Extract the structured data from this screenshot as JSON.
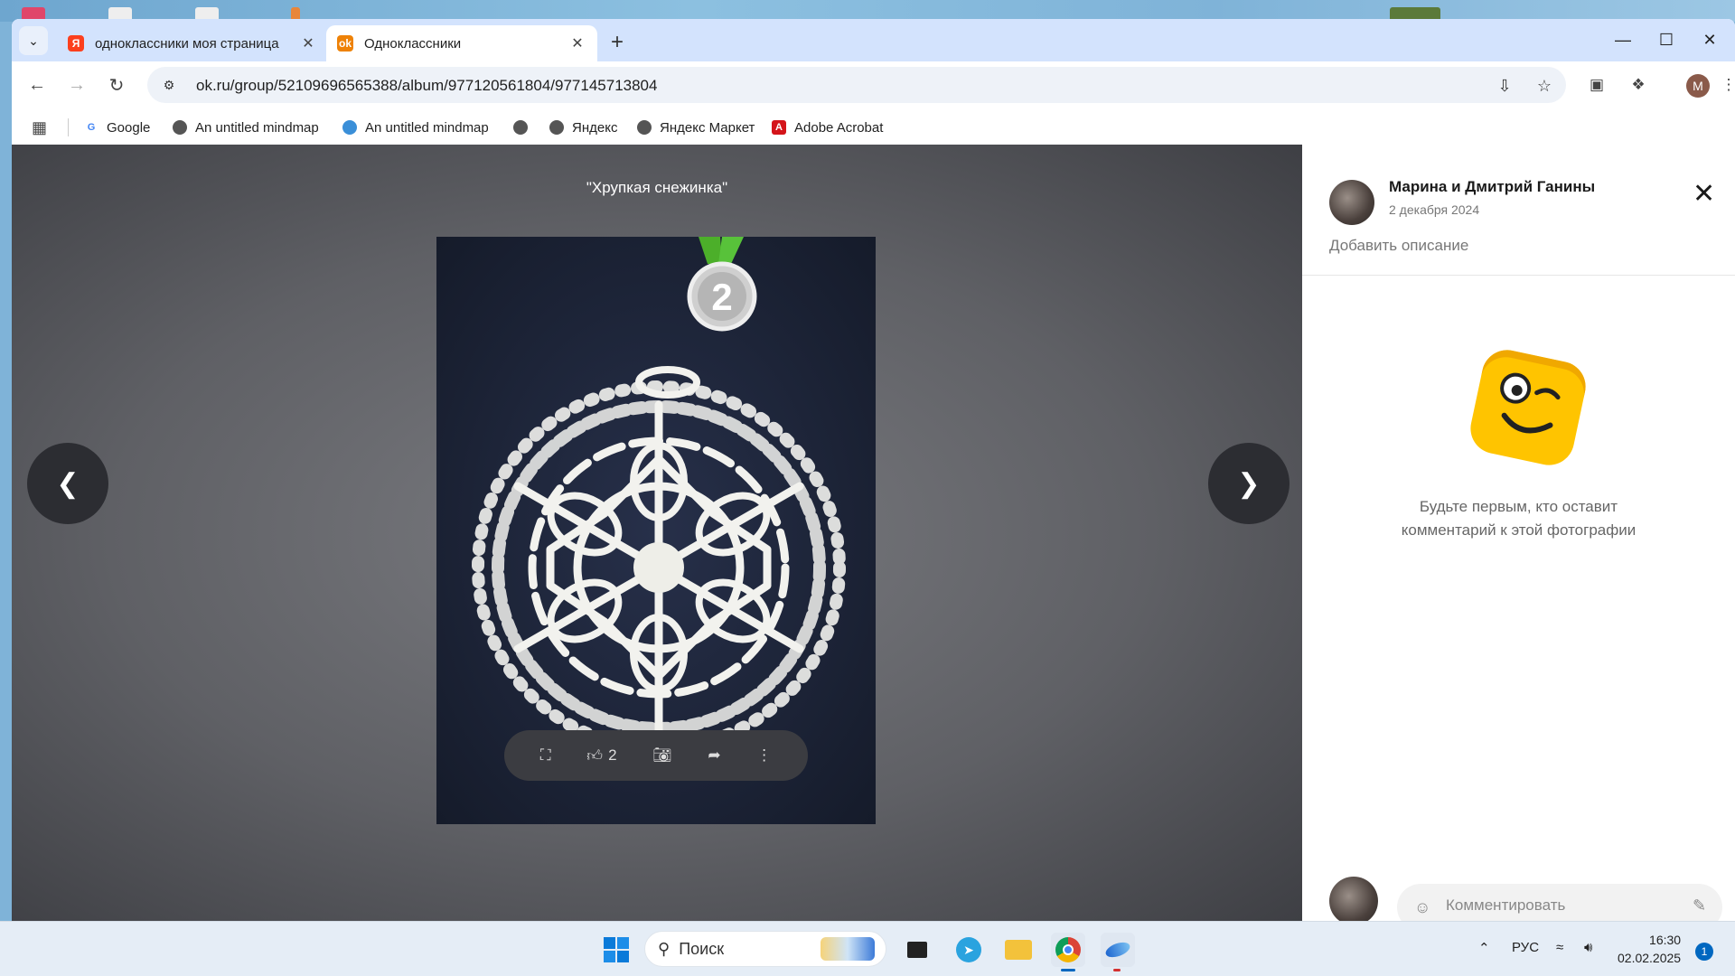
{
  "browser": {
    "tabs": [
      {
        "title": "одноклассники моя страница",
        "favicon": "yandex-favicon",
        "active": false
      },
      {
        "title": "Одноклассники",
        "favicon": "ok-favicon",
        "active": true
      }
    ],
    "url": "ok.ru/group/52109696565388/album/977120561804/977145713804",
    "profile_initial": "M",
    "bookmarks": [
      {
        "label": "Google",
        "icon": "google-icon"
      },
      {
        "label": "An untitled mindmap",
        "icon": "globe-icon"
      },
      {
        "label": "An untitled mindmap",
        "icon": "mindmap-icon"
      },
      {
        "label": "",
        "icon": "globe-icon"
      },
      {
        "label": "Яндекс",
        "icon": "globe-icon"
      },
      {
        "label": "Яндекс Маркет",
        "icon": "globe-icon"
      },
      {
        "label": "Adobe Acrobat",
        "icon": "acrobat-icon"
      }
    ]
  },
  "viewer": {
    "photo_title": "\"Хрупкая снежинка\"",
    "badge_number": "2",
    "like_count": "2",
    "actions": [
      "fullscreen-icon",
      "like-icon",
      "camera-icon",
      "share-icon",
      "more-icon"
    ]
  },
  "sidepanel": {
    "author": "Марина и Дмитрий Ганины",
    "date": "2 декабря 2024",
    "add_description": "Добавить описание",
    "empty_comments_line1": "Будьте первым, кто оставит",
    "empty_comments_line2": "комментарий к этой фотографии",
    "comment_placeholder": "Комментировать"
  },
  "taskbar": {
    "search_label": "Поиск",
    "language": "РУС",
    "time": "16:30",
    "date": "02.02.2025",
    "notifications": "1"
  },
  "colors": {
    "tabbar_bg": "#d3e3fd",
    "ok_orange": "#ee8208",
    "medal_green": "#4caf2a",
    "emoji_yellow": "#ffc400"
  }
}
